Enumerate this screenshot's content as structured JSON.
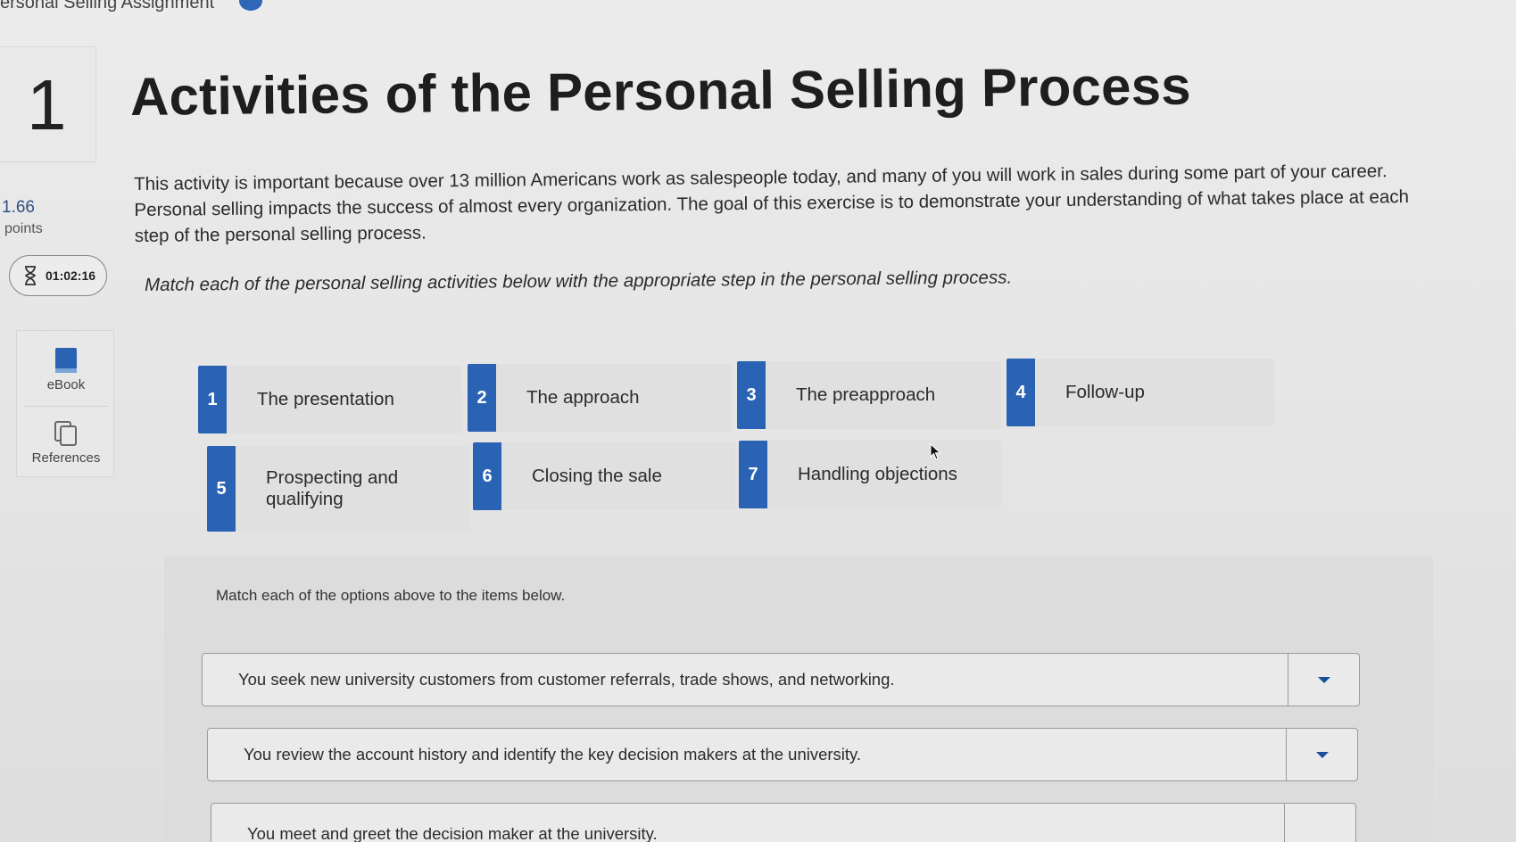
{
  "header": {
    "crumb": "ersonal Selling Assignment"
  },
  "question": {
    "number": "1",
    "title": "Activities of the Personal Selling Process",
    "points_value": "1.66",
    "points_label": "points",
    "timer": "01:02:16",
    "intro": "This activity is important because over 13 million Americans work as salespeople today, and many of you will work in sales during some part of your career. Personal selling impacts the success of almost every organization. The goal of this exercise is to demonstrate your understanding of what takes place at each step of the personal selling process.",
    "instruction": "Match each of the personal selling activities below with the appropriate step in the personal selling process."
  },
  "tools": {
    "ebook_label": "eBook",
    "references_label": "References"
  },
  "options": [
    {
      "num": "1",
      "label": "The presentation"
    },
    {
      "num": "2",
      "label": "The approach"
    },
    {
      "num": "3",
      "label": "The preapproach"
    },
    {
      "num": "4",
      "label": "Follow-up"
    },
    {
      "num": "5",
      "label": "Prospecting and qualifying"
    },
    {
      "num": "6",
      "label": "Closing the sale"
    },
    {
      "num": "7",
      "label": "Handling objections"
    }
  ],
  "match": {
    "title": "Match each of the options above to the items below.",
    "items": [
      {
        "text": "You seek new university customers from customer referrals, trade shows, and networking."
      },
      {
        "text": "You review the account history and identify the key decision makers at the university."
      },
      {
        "text": "You meet and greet the decision maker at the university."
      }
    ]
  },
  "colors": {
    "accent_blue": "#2a62b4",
    "points_blue": "#2f4f86"
  },
  "icons": [
    "info-icon",
    "hourglass-icon",
    "ebook-icon",
    "references-icon",
    "chevron-down-icon",
    "mouse-cursor-icon"
  ]
}
